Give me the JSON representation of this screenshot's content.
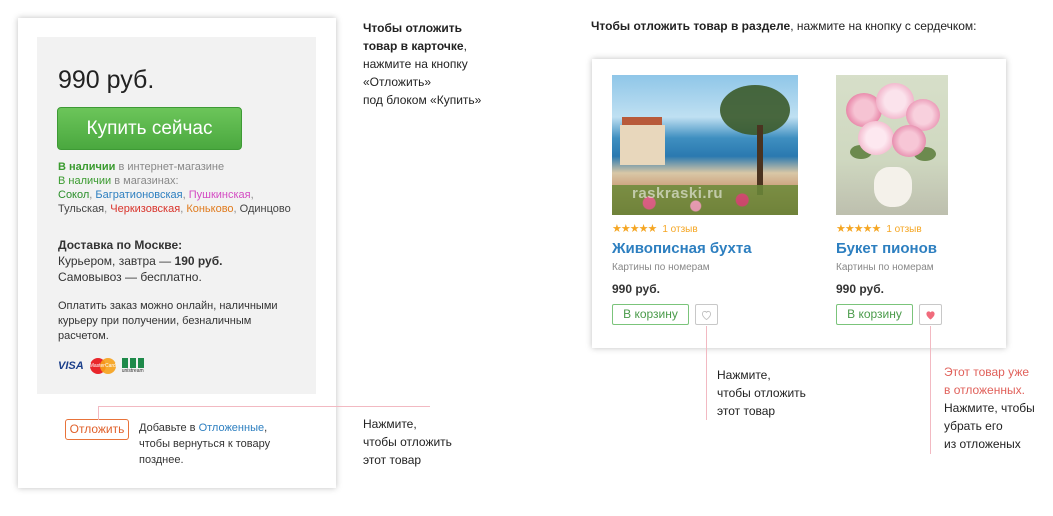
{
  "left_card": {
    "price": "990 руб.",
    "buy_button": "Купить сейчас",
    "availability": {
      "online_status": "В наличии",
      "online_suffix": " в интернет-магазине",
      "stores_status": "В наличии",
      "stores_suffix": " в магазинах:",
      "stores": [
        "Сокол",
        "Багратионовская",
        "Пушкинская",
        "Тульская",
        "Черкизовская",
        "Коньково",
        "Одинцово"
      ]
    },
    "delivery": {
      "title": "Доставка по Москве:",
      "courier_prefix": "Курьером, завтра — ",
      "courier_price": "190 руб.",
      "pickup": "Самовывоз — бесплатно."
    },
    "payment_info": "Оплатить заказ можно онлайн, наличными курьеру при получении, безналичным расчетом.",
    "pay_logos": {
      "visa": "VISA",
      "mastercard": "MasterCard",
      "unistream": "unistream"
    },
    "postpone_button": "Отложить",
    "postpone_note_prefix": "Добавьте в ",
    "postpone_note_link": "Отложенные",
    "postpone_note_suffix": ", чтобы вернуться к товару позднее."
  },
  "annotations": {
    "mid_top_bold1": "Чтобы отложить",
    "mid_top_bold2": "товар в карточке",
    "mid_top_comma": ",",
    "mid_top_line3": "нажмите на кнопку",
    "mid_top_line4": "«Отложить»",
    "mid_top_line5": "под блоком «Купить»",
    "mid_bottom": [
      "Нажмите,",
      "чтобы отложить",
      "этот товар"
    ],
    "right_top_bold": "Чтобы отложить товар в разделе",
    "right_top_rest": ", нажмите на кнопку с сердечком:",
    "right_bottom1": [
      "Нажмите,",
      "чтобы отложить",
      "этот товар"
    ],
    "right_bottom2_red": [
      "Этот товар уже",
      "в отложенных."
    ],
    "right_bottom2": [
      "Нажмите, чтобы",
      "убрать его",
      "из отложеных"
    ]
  },
  "products": [
    {
      "rating_stars": "★★★★★",
      "reviews": "1 отзыв",
      "name": "Живописная бухта",
      "category": "Картины по номерам",
      "price": "990 руб.",
      "cart_button": "В корзину",
      "watermark": "raskraski.ru",
      "favorited": false
    },
    {
      "rating_stars": "★★★★★",
      "reviews": "1 отзыв",
      "name": "Букет пионов",
      "category": "Картины по номерам",
      "price": "990 руб.",
      "cart_button": "В корзину",
      "favorited": true
    }
  ],
  "colors": {
    "accent_green": "#4aa83f",
    "link_blue": "#2d7fc0",
    "postpone_orange": "#e0602a",
    "heart_pink": "#f06b7c",
    "star_orange": "#f5a623"
  }
}
